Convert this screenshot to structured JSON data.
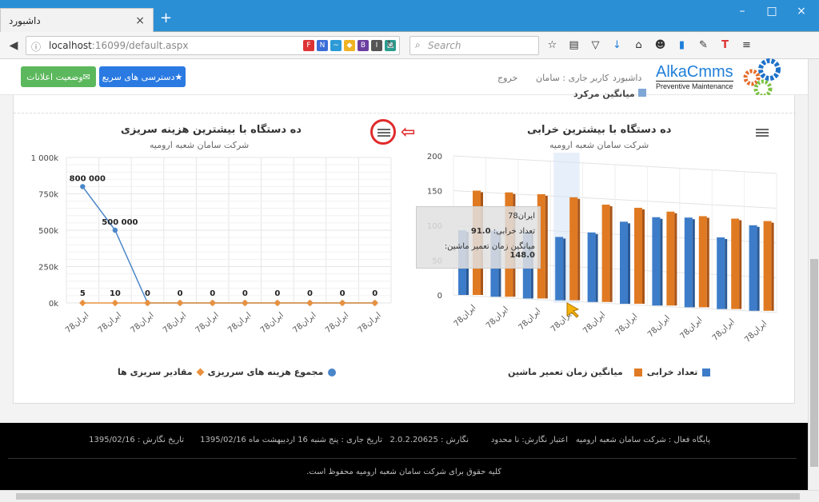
{
  "browser": {
    "tab_title": "داشبورد",
    "tab_close": "×",
    "new_tab": "+",
    "url_host": "localhost",
    "url_rest": ":16099/default.aspx",
    "search_placeholder": "Search",
    "window_controls": [
      "–",
      "□",
      "×"
    ]
  },
  "header": {
    "btn_notifications": "وضعیت اعلانات",
    "btn_quick_access": "دسترسی های سریع",
    "menu": [
      "داشبورد",
      "کاربر جاری : سامان",
      "خروج"
    ],
    "logo_title": "AlkaCmms",
    "logo_subtitle": "Preventive Maintenance"
  },
  "top_partial_legend": "میانگین مرکرد",
  "chart_left": {
    "title": "ده دستگاه با بیشترین هزینه سریزی",
    "subtitle": "شرکت سامان شعبه ارومیه",
    "yticks": [
      "1 000k",
      "750k",
      "500k",
      "250k",
      "0k"
    ],
    "legend": [
      "مجموع هزینه های سرریزی",
      "مقادیر سریزی ها"
    ],
    "colors": {
      "cost": "#4a86c8",
      "count": "#e9913e"
    }
  },
  "chart_right": {
    "title": "ده دستگاه با بیشترین خرابی",
    "subtitle": "شرکت سامان شعبه ارومیه",
    "yticks": [
      "200",
      "150",
      "100",
      "50",
      "0"
    ],
    "legend": [
      "تعداد خرابی",
      "میانگین زمان تعمیر ماشین"
    ],
    "colors": {
      "failures": "#3d7cc9",
      "repair": "#e07a22"
    }
  },
  "tooltip": {
    "title": "ایران78",
    "line1_label": "تعداد خرابی:",
    "line1_value": "91.0",
    "line2_label": "میانگین زمان تعمیر ماشین:",
    "line2_value": "148.0"
  },
  "chart_data": [
    {
      "type": "line",
      "title": "ده دستگاه با بیشترین هزینه سریزی",
      "subtitle": "شرکت سامان شعبه ارومیه",
      "categories": [
        "ایران78",
        "ایران78",
        "ایران78",
        "ایران78",
        "ایران78",
        "ایران78",
        "ایران78",
        "ایران78",
        "ایران78",
        "ایران78"
      ],
      "ylim": [
        0,
        1000000
      ],
      "series": [
        {
          "name": "مجموع هزینه های سرریزی",
          "values": [
            800000,
            500000,
            0,
            0,
            0,
            0,
            0,
            0,
            0,
            0
          ],
          "labels": [
            "800 000",
            "500 000",
            "0",
            "0",
            "0",
            "0",
            "0",
            "0",
            "0",
            "0"
          ]
        },
        {
          "name": "مقادیر سریزی ها",
          "values": [
            5,
            10,
            0,
            0,
            0,
            0,
            0,
            0,
            0,
            0
          ],
          "labels": [
            "5",
            "10",
            "0",
            "0",
            "0",
            "0",
            "0",
            "0",
            "0",
            "0"
          ]
        }
      ],
      "legend": "bottom"
    },
    {
      "type": "bar",
      "title": "ده دستگاه با بیشترین خرابی",
      "subtitle": "شرکت سامان شعبه ارومیه",
      "categories": [
        "ایران78",
        "ایران78",
        "ایران78",
        "ایران78",
        "ایران78",
        "ایران78",
        "ایران78",
        "ایران78",
        "ایران78",
        "ایران78"
      ],
      "ylim": [
        0,
        200
      ],
      "series": [
        {
          "name": "تعداد خرابی",
          "values": [
            93,
            95,
            96,
            91,
            100,
            118,
            127,
            129,
            103,
            123
          ]
        },
        {
          "name": "میانگین زمان تعمیر ماشین",
          "values": [
            150,
            150,
            150,
            148,
            140,
            138,
            135,
            131,
            130,
            129
          ]
        }
      ],
      "legend": "bottom"
    }
  ],
  "footer": {
    "active_base": "پایگاه فعال : شرکت سامان شعبه ارومیه",
    "license": "اعتبار نگارش: نا محدود",
    "version": "نگارش : 2.0.2.20625",
    "today": "تاریخ جاری : پنج شنبه 16 اردیبهشت ماه 1395/02/16",
    "build_date": "تاریخ نگارش : 1395/02/16",
    "copyright": "کلیه حقوق برای شرکت سامان شعبه ارومیه محفوظ است."
  }
}
